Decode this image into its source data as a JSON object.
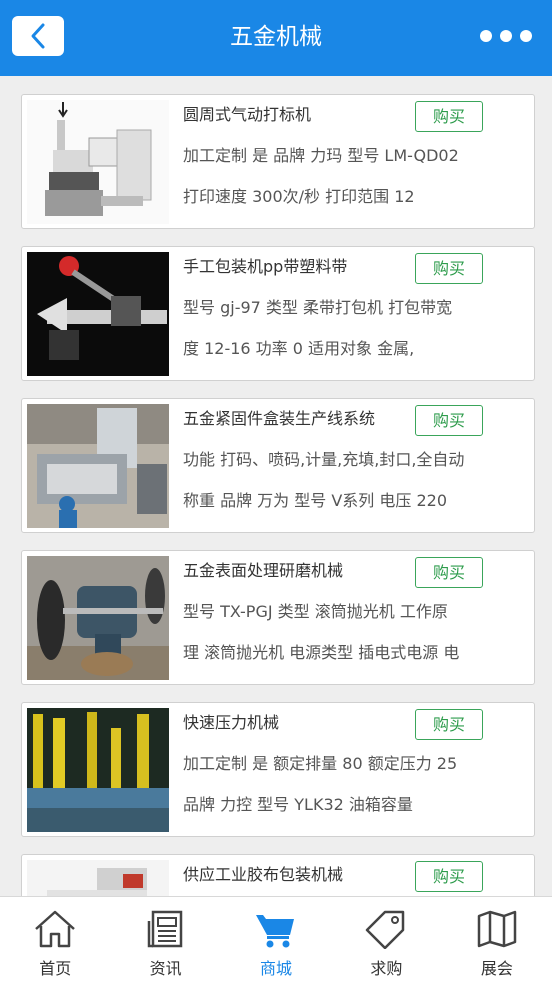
{
  "header": {
    "title": "五金机械"
  },
  "buy_label": "购买",
  "colors": {
    "header": "#1a87e6",
    "buy": "#2e9c4c",
    "tab_active": "#1a87e6"
  },
  "products": [
    {
      "name": "圆周式气动打标机",
      "desc1": "加工定制 是 品牌 力玛 型号 LM-QD02",
      "desc2": "打印速度 300次/秒 打印范围 12"
    },
    {
      "name": "手工包装机pp带塑料带",
      "desc1": "型号 gj-97 类型 柔带打包机 打包带宽",
      "desc2": "度 12-16 功率 0 适用对象 金属,"
    },
    {
      "name": "五金紧固件盒装生产线系统",
      "desc1": "功能 打码、喷码,计量,充填,封口,全自动",
      "desc2": "称重 品牌 万为 型号 V系列 电压 220"
    },
    {
      "name": "五金表面处理研磨机械",
      "desc1": "型号 TX-PGJ 类型 滚筒抛光机 工作原",
      "desc2": "理 滚筒抛光机 电源类型 插电式电源 电"
    },
    {
      "name": "快速压力机械",
      "desc1": "加工定制 是 额定排量 80 额定压力 25",
      "desc2": "品牌 力控 型号 YLK32 油箱容量"
    },
    {
      "name": "供应工业胶布包装机械",
      "desc1": "",
      "desc2": ""
    }
  ],
  "tabs": [
    {
      "label": "首页",
      "icon": "home-icon"
    },
    {
      "label": "资讯",
      "icon": "news-icon"
    },
    {
      "label": "商城",
      "icon": "cart-icon",
      "active": true
    },
    {
      "label": "求购",
      "icon": "tag-icon"
    },
    {
      "label": "展会",
      "icon": "map-icon"
    }
  ]
}
